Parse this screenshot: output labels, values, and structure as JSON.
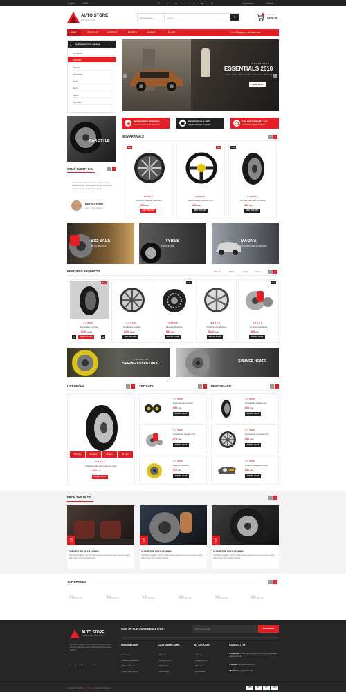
{
  "topbar": {
    "language": "English",
    "currency": "USD",
    "account": "My account",
    "wishlist": "Wishlist"
  },
  "header": {
    "brand": "AUTO STORE",
    "tagline": "Car Parts Center",
    "category_select": "All Categories",
    "search_placeholder": "Search",
    "cart_label": "Your Cart",
    "cart_total": "$628.00"
  },
  "nav": {
    "items": [
      "HOME",
      "WHEELS",
      "MIRROR",
      "LIGHTS",
      "AUDIO",
      "BLOG"
    ],
    "promo": "Free Shipping on all order now"
  },
  "sidebar": {
    "title": "CATEGORIES MENU",
    "items": [
      "Mercedes",
      "Hyundai",
      "Toyota",
      "Chevrolet",
      "Audi",
      "BMW",
      "Lexus",
      "Hyundai"
    ]
  },
  "banner": {
    "kicker": "JUST ARRIVED",
    "title": "ESSENTIALS 2018",
    "sub": "Lorem ipsum dolor sit amet, consectetur adipiscing elit",
    "button": "SHOP NOW"
  },
  "features": [
    {
      "title": "WORLDWIDE SHIPPING",
      "text": "Free ship in the world over shop",
      "icon": "plane-icon"
    },
    {
      "title": "PROMOTION & GIFT",
      "text": "Special treatment for weekly",
      "icon": "gift-icon"
    },
    {
      "title": "ONLINE SUPPORT 24/7",
      "text": "24/7 online support is always",
      "icon": "headset-icon"
    }
  ],
  "carstyle": {
    "label": "CAR STYLE"
  },
  "testimonial": {
    "title": "WHAT CLIENT SAY",
    "quote": "Lorem ipsum dolor sit amet, consectetur adipiscing elit. Vestibulum luctus, ante dolor tempus nunc, scelerisque a felis.",
    "name": "MARTIN SYDNEY",
    "role": "CEO - ThemeMaster"
  },
  "new_arrivals": {
    "title": "NEW ARRIVALS",
    "products": [
      {
        "name": "Maximus creasor, vitae felis",
        "price": "$10",
        "old": "$30",
        "badge": "Sale",
        "button": "ADD TO CART",
        "kind": "rim"
      },
      {
        "name": "Pellentesque suscipit, arcu",
        "price": "$20",
        "old": "$45",
        "badge": "Sale",
        "button": "ADD TO CART",
        "kind": "wheel"
      },
      {
        "name": "Porttitor sed odio ut massa",
        "price": "$40",
        "old": "$65",
        "badge": "New",
        "button": "ADD TO CART",
        "kind": "tire"
      }
    ]
  },
  "promos": [
    {
      "title": "BIG SALE",
      "sub": "UP TO 50% OFF"
    },
    {
      "title": "TYRES",
      "sub": "FROM $70.00"
    },
    {
      "title": "MAGNA",
      "sub": "SOLUTION FOR ALL ROADS"
    }
  ],
  "featured": {
    "title": "FEATURED PRODUCTS",
    "tabs": [
      "Wheels",
      "Mirror",
      "Lights",
      "Audio"
    ],
    "products": [
      {
        "name": "Accumsan et. Cras",
        "price": "$120",
        "old": "$150",
        "badge": "Sale",
        "button": "ADD TO CART",
        "kind": "tire"
      },
      {
        "name": "Vestibulum sagittis",
        "price": "$200",
        "old": "$250",
        "badge": "",
        "button": "ADD TO CART",
        "kind": "rim"
      },
      {
        "name": "Aliquam tincidunt",
        "price": "$80",
        "old": "$95",
        "badge": "New",
        "button": "ADD TO CART",
        "kind": "chain"
      },
      {
        "name": "Porttitor nisl ultricies",
        "price": "$120",
        "old": "$150",
        "badge": "",
        "button": "ADD TO CART",
        "kind": "rim"
      },
      {
        "name": "Ut accumsantisma",
        "price": "$65",
        "old": "$85",
        "badge": "New",
        "button": "ADD TO CART",
        "kind": "brake"
      }
    ]
  },
  "mid_banners": [
    {
      "kicker": "INSPIRATION",
      "title": "SPRING ESSENTIALS"
    },
    {
      "kicker": "",
      "title": "SUMMER HEATS"
    }
  ],
  "hot_deals": {
    "title": "HOT DEALS",
    "countdown": [
      "285 Days",
      "24 Hours",
      "59 Mins",
      "58 Secs"
    ],
    "name": "Dignissim dui accumsan et. Cras",
    "price": "$40",
    "old": "$50",
    "button": "ADD TO CART"
  },
  "top_rate": {
    "title": "TOP RATE",
    "items": [
      {
        "name": "Pellentesque suscipit",
        "price": "$50",
        "old": "$60",
        "button": "ADD TO CART",
        "kind": "brake-set"
      },
      {
        "name": "Vestibulum sagittis, nisl",
        "price": "$75",
        "old": "$80",
        "button": "ADD TO CART",
        "kind": "brake"
      },
      {
        "name": "Aliquam tincidunt",
        "price": "$70",
        "old": "$80",
        "button": "ADD TO CART",
        "kind": "clutch"
      }
    ]
  },
  "best_seller": {
    "title": "BEST SELLER",
    "items": [
      {
        "name": "Vestibulum sagittis nisl",
        "price": "$20",
        "old": "$30",
        "button": "ADD TO CART",
        "kind": "tire"
      },
      {
        "name": "Dignissima vulputate dui",
        "price": "$80",
        "old": "$90",
        "button": "ADD TO CART",
        "kind": "rim"
      },
      {
        "name": "Nihae Gubulat erat, dico",
        "price": "$40",
        "old": "$50",
        "button": "ADD TO CART",
        "kind": "light"
      }
    ]
  },
  "blog": {
    "title": "FROM THE BLOG",
    "posts": [
      {
        "day": "11",
        "month": "Dec",
        "title": "CURABITUR LIGULASAPIEN",
        "text": "Vestibulum sagittis, nisl nec pellentesque suscipit arcu dui maximus neque vitae finibus enim augue quis dui."
      },
      {
        "day": "11",
        "month": "Dec",
        "title": "CURABITUR LIGULASAPIEN",
        "text": "Vestibulum sagittis, nisl nec pellentesque suscipit arcu dui maximus neque vitae finibus enim augue quis dui."
      },
      {
        "day": "11",
        "month": "Dec",
        "title": "CURABITUR LIGULASAPIEN",
        "text": "Vestibulum sagittis, nisl nec pellentesque suscipit arcu dui maximus neque vitae finibus enim augue quis dui."
      }
    ]
  },
  "brands": {
    "title": "TOP BRANDS",
    "items": [
      "BRAND",
      "BRAND",
      "BRAND",
      "BRAND",
      "BRAND",
      "BRAND"
    ]
  },
  "footer": {
    "brand": "AUTO STORE",
    "tagline": "Complete Car Parts Center",
    "about": "Vestibulum sagittis, nisl nec pellentesque suscipit, arcu dui maximus neque, vitae finibus enim augue quis dui.",
    "newsletter": "SIGN UP FOR OUR NEWSLETTER !",
    "email_placeholder": "Enter your email",
    "subscribe": "SUBSCRIBE",
    "cols": [
      {
        "title": "INFORMATION",
        "items": [
          "Careers",
          "Investor Relations",
          "Press Releases",
          "Shop with Points"
        ]
      },
      {
        "title": "CUSTOMER CARE",
        "items": [
          "Returns",
          "Shipping Info",
          "Gift Cards",
          "Size Guide"
        ]
      },
      {
        "title": "MY ACCOUNT",
        "items": [
          "Returns",
          "Shipping Info",
          "Gift Cards",
          "Size Guide"
        ]
      }
    ],
    "contact_title": "CONTACT US",
    "address_label": "Address:",
    "address": "Lorem ipsum dolor sit amet, consectetur adipiscing elit",
    "email_label": "Email:",
    "email": "info@themes.com",
    "phone_label": "Phone:",
    "phone": "(+01) 456 789",
    "copyright": "Copyright © 2018",
    "credit": "Field Themes",
    "rights": "All rights reserved.",
    "payments": [
      "VISA",
      "MC",
      "PP",
      "AMEX"
    ]
  },
  "colors": {
    "accent": "#e31e24",
    "dark": "#222222",
    "footer": "#262626"
  }
}
